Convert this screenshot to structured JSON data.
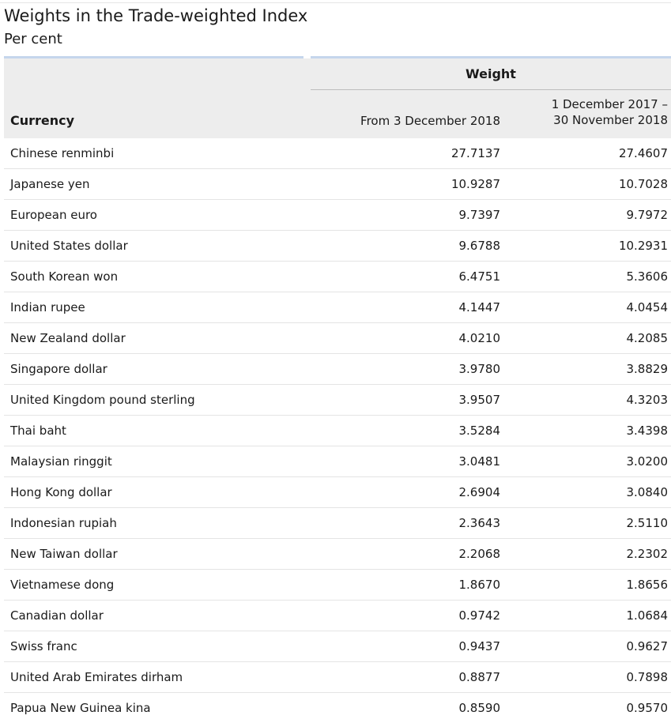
{
  "title": "Weights in the Trade-weighted Index",
  "subtitle": "Per cent",
  "table": {
    "group_header": "Weight",
    "columns": {
      "currency": "Currency",
      "from": "From 3 December 2018",
      "prev_line1": "1 December 2017 –",
      "prev_line2": "30 November 2018"
    },
    "rows": [
      {
        "currency": "Chinese renminbi",
        "from": "27.7137",
        "prev": "27.4607"
      },
      {
        "currency": "Japanese yen",
        "from": "10.9287",
        "prev": "10.7028"
      },
      {
        "currency": "European euro",
        "from": "9.7397",
        "prev": "9.7972"
      },
      {
        "currency": "United States dollar",
        "from": "9.6788",
        "prev": "10.2931"
      },
      {
        "currency": "South Korean won",
        "from": "6.4751",
        "prev": "5.3606"
      },
      {
        "currency": "Indian rupee",
        "from": "4.1447",
        "prev": "4.0454"
      },
      {
        "currency": "New Zealand dollar",
        "from": "4.0210",
        "prev": "4.2085"
      },
      {
        "currency": "Singapore dollar",
        "from": "3.9780",
        "prev": "3.8829"
      },
      {
        "currency": "United Kingdom pound sterling",
        "from": "3.9507",
        "prev": "4.3203"
      },
      {
        "currency": "Thai baht",
        "from": "3.5284",
        "prev": "3.4398"
      },
      {
        "currency": "Malaysian ringgit",
        "from": "3.0481",
        "prev": "3.0200"
      },
      {
        "currency": "Hong Kong dollar",
        "from": "2.6904",
        "prev": "3.0840"
      },
      {
        "currency": "Indonesian rupiah",
        "from": "2.3643",
        "prev": "2.5110"
      },
      {
        "currency": "New Taiwan dollar",
        "from": "2.2068",
        "prev": "2.2302"
      },
      {
        "currency": "Vietnamese dong",
        "from": "1.8670",
        "prev": "1.8656"
      },
      {
        "currency": "Canadian dollar",
        "from": "0.9742",
        "prev": "1.0684"
      },
      {
        "currency": "Swiss franc",
        "from": "0.9437",
        "prev": "0.9627"
      },
      {
        "currency": "United Arab Emirates dirham",
        "from": "0.8877",
        "prev": "0.7898"
      },
      {
        "currency": "Papua New Guinea kina",
        "from": "0.8590",
        "prev": "0.9570"
      }
    ]
  },
  "colors": {
    "accent_rule": "#c5d6ec",
    "header_bg": "#ededed",
    "row_divider": "#e4e4e4"
  }
}
